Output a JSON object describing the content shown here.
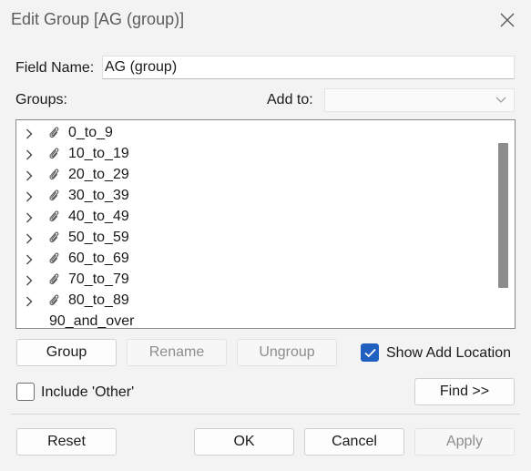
{
  "window": {
    "title": "Edit Group [AG (group)]"
  },
  "field_name": {
    "label": "Field Name:",
    "value": "AG (group)"
  },
  "groups": {
    "label": "Groups:"
  },
  "add_to": {
    "label": "Add to:",
    "value": ""
  },
  "tree": {
    "items": [
      {
        "label": "0_to_9",
        "expandable": true
      },
      {
        "label": "10_to_19",
        "expandable": true
      },
      {
        "label": "20_to_29",
        "expandable": true
      },
      {
        "label": "30_to_39",
        "expandable": true
      },
      {
        "label": "40_to_49",
        "expandable": true
      },
      {
        "label": "50_to_59",
        "expandable": true
      },
      {
        "label": "60_to_69",
        "expandable": true
      },
      {
        "label": "70_to_79",
        "expandable": true
      },
      {
        "label": "80_to_89",
        "expandable": true
      },
      {
        "label": "90_and_over",
        "expandable": false
      }
    ]
  },
  "buttons": {
    "group": "Group",
    "rename": "Rename",
    "ungroup": "Ungroup",
    "find": "Find >>",
    "reset": "Reset",
    "ok": "OK",
    "cancel": "Cancel",
    "apply": "Apply"
  },
  "checkboxes": {
    "show_add_location": {
      "label": "Show Add Location",
      "checked": true
    },
    "include_other": {
      "label": "Include 'Other'",
      "checked": false
    }
  },
  "colors": {
    "accent": "#1f5fbf",
    "tree_border": "#8a8a8a",
    "background": "#f3f3f3"
  }
}
